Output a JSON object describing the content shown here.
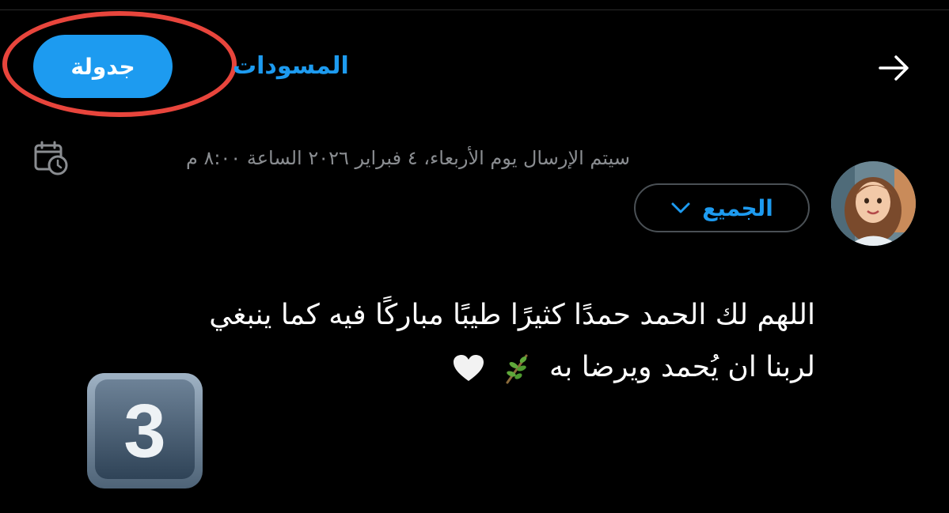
{
  "top_bar": {
    "schedule_label": "جدولة",
    "drafts_label": "المسودات",
    "back_icon": "arrow-right-icon"
  },
  "schedule_notice": {
    "text": "سيتم الإرسال يوم الأربعاء، ٤ فبراير ٢٠٢٦ الساعة ٨:٠٠ م",
    "icon": "calendar-clock-icon"
  },
  "composer": {
    "audience_label": "الجميع",
    "tweet_line_1": "اللهم لك الحمد حمدًا كثيرًا طيبًا مباركًا فيه كما ينبغي",
    "tweet_line_2": "لربنا ان يُحمد ويرضا به",
    "emojis": [
      "herb-icon",
      "white-heart-icon"
    ]
  },
  "overlay": {
    "keycap": "3"
  },
  "colors": {
    "accent": "#1d9bf0",
    "background": "#000000",
    "muted_text": "#8a8d91",
    "highlight": "#e8453c"
  }
}
